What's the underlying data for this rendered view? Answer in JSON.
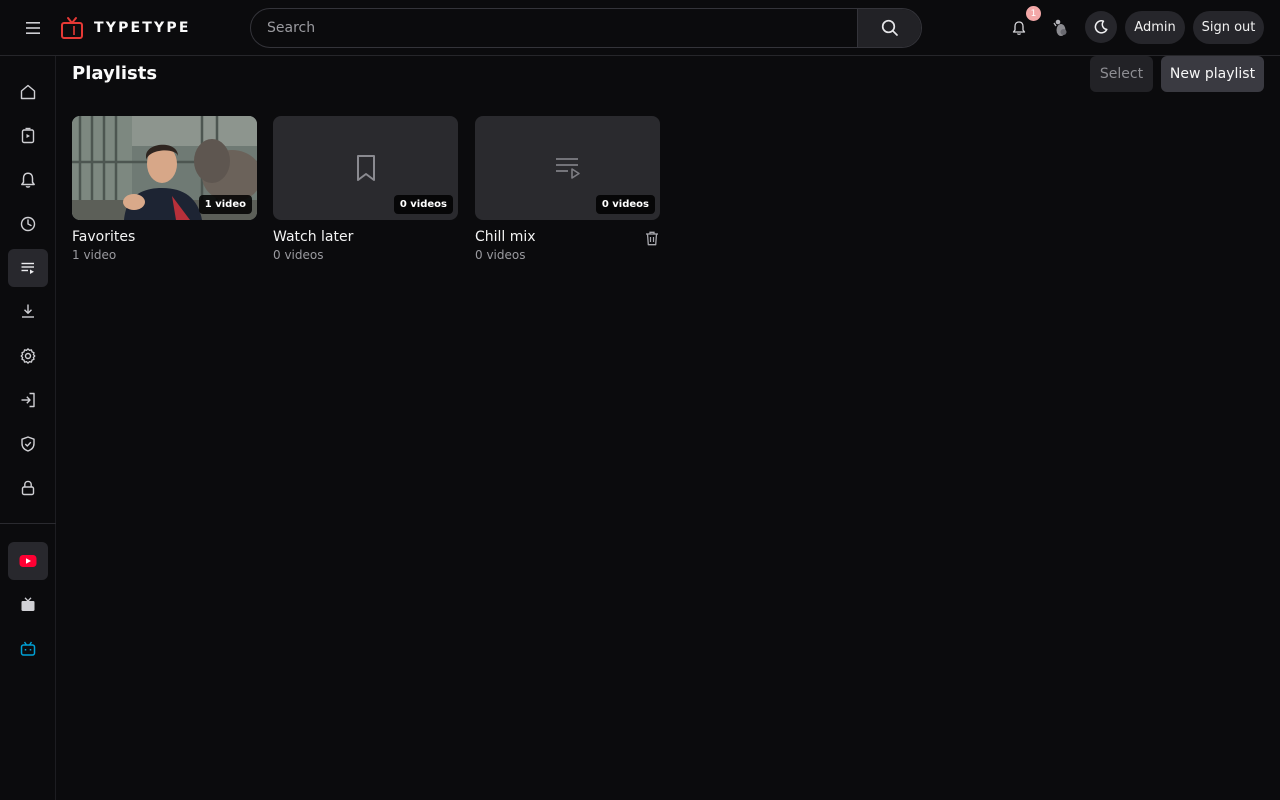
{
  "header": {
    "brand": "TYPETYPE",
    "search": {
      "placeholder": "Search",
      "value": ""
    },
    "notification_count": "1",
    "admin_label": "Admin",
    "signout_label": "Sign out"
  },
  "sidebar": {
    "items": [
      {
        "name": "home",
        "icon": "home-icon"
      },
      {
        "name": "subscriptions",
        "icon": "subscriptions-icon"
      },
      {
        "name": "notifications",
        "icon": "bell-icon"
      },
      {
        "name": "history",
        "icon": "clock-icon"
      },
      {
        "name": "playlists",
        "icon": "playlist-icon",
        "active": true
      },
      {
        "name": "downloads",
        "icon": "download-icon"
      },
      {
        "name": "settings",
        "icon": "gear-icon"
      },
      {
        "name": "login",
        "icon": "login-icon"
      },
      {
        "name": "admin",
        "icon": "shield-check-icon"
      },
      {
        "name": "privacy",
        "icon": "lock-icon"
      }
    ],
    "services": [
      {
        "name": "youtube",
        "icon": "youtube-icon",
        "active": true,
        "color": "#ff0033"
      },
      {
        "name": "tv",
        "icon": "tv-icon"
      },
      {
        "name": "bilibili",
        "icon": "bilibili-icon",
        "color": "#00a1d6"
      }
    ]
  },
  "main": {
    "title": "Playlists",
    "select_label": "Select",
    "new_playlist_label": "New playlist",
    "playlists": [
      {
        "title": "Favorites",
        "count_badge": "1 video",
        "subtitle": "1 video",
        "thumbnail": "photo",
        "icon": "video-thumbnail"
      },
      {
        "title": "Watch later",
        "count_badge": "0 videos",
        "subtitle": "0 videos",
        "thumbnail": "placeholder",
        "icon": "bookmark-icon"
      },
      {
        "title": "Chill mix",
        "count_badge": "0 videos",
        "subtitle": "0 videos",
        "thumbnail": "placeholder",
        "icon": "playlist-play-icon",
        "deletable": true
      }
    ]
  },
  "colors": {
    "background": "#0b0b0d",
    "accent_red": "#e53935",
    "badge": "#f3a8a8",
    "card_placeholder": "#2a2a2e"
  }
}
